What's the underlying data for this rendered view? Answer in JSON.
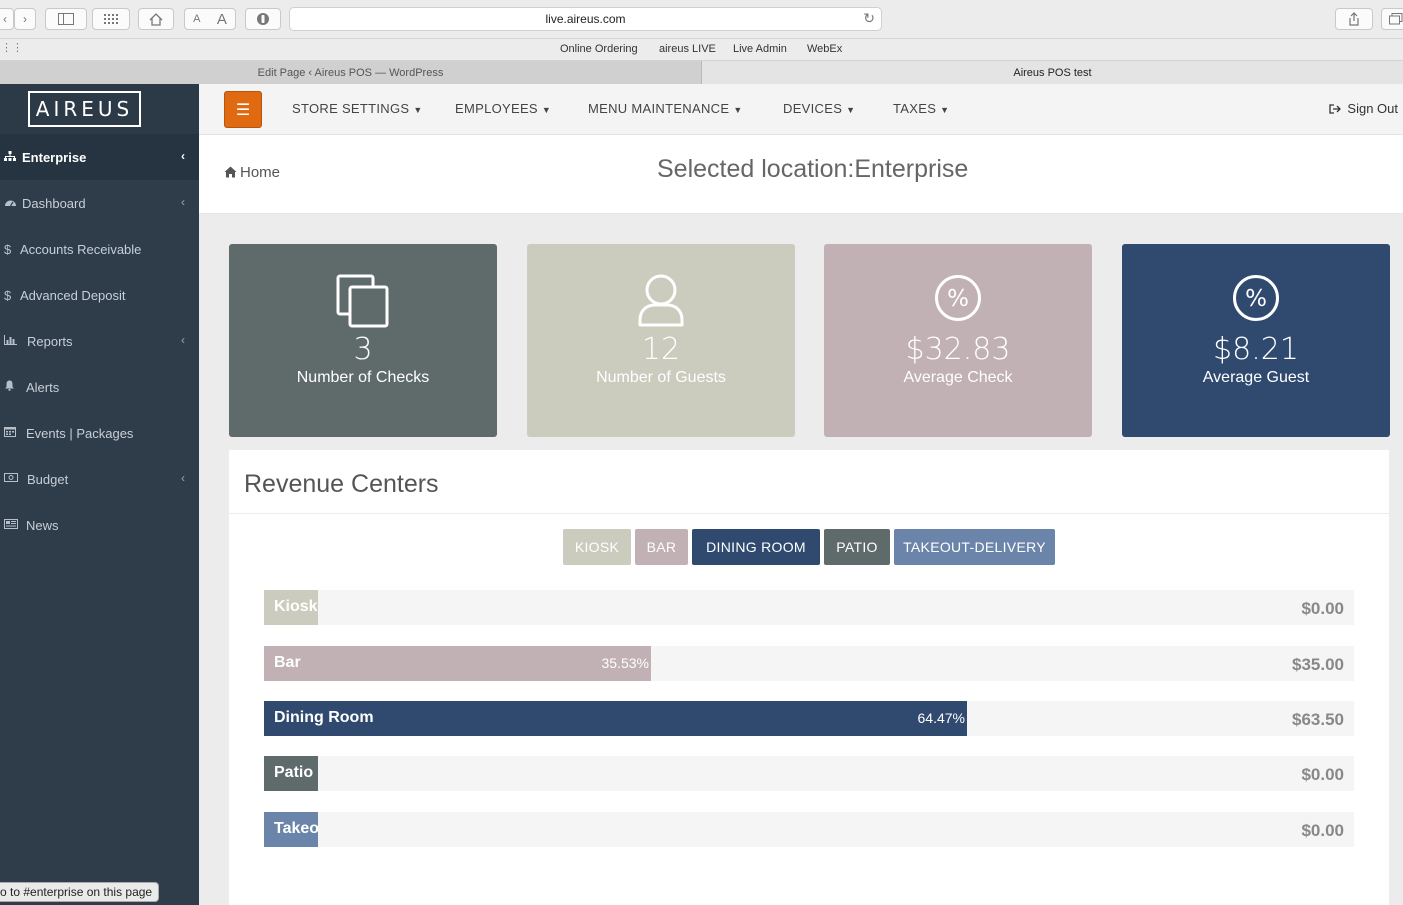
{
  "browser": {
    "url": "live.aireus.com",
    "bookmarks": [
      "Online Ordering",
      "aireus LIVE",
      "Live Admin",
      "WebEx"
    ],
    "tabs": [
      {
        "label": "Edit Page ‹ Aireus POS — WordPress",
        "active": false
      },
      {
        "label": "Aireus POS test",
        "active": true
      }
    ],
    "status_text": "o to #enterprise on this page",
    "font_small": "A",
    "font_large": "A"
  },
  "sidebar": {
    "logo": "AIREUS",
    "items": [
      {
        "label": "Enterprise",
        "icon": "sitemap-icon",
        "active": true,
        "chevron": true
      },
      {
        "label": "Dashboard",
        "icon": "dashboard-icon",
        "active": false,
        "chevron": true
      },
      {
        "label": "Accounts Receivable",
        "icon": "dollar-icon",
        "active": false,
        "chevron": false
      },
      {
        "label": "Advanced Deposit",
        "icon": "dollar-icon",
        "active": false,
        "chevron": false
      },
      {
        "label": "Reports",
        "icon": "bar-chart-icon",
        "active": false,
        "chevron": true
      },
      {
        "label": "Alerts",
        "icon": "bell-icon",
        "active": false,
        "chevron": false
      },
      {
        "label": "Events | Packages",
        "icon": "calendar-icon",
        "active": false,
        "chevron": false
      },
      {
        "label": "Budget",
        "icon": "money-icon",
        "active": false,
        "chevron": true
      },
      {
        "label": "News",
        "icon": "newspaper-icon",
        "active": false,
        "chevron": false
      }
    ]
  },
  "topnav": {
    "menus": [
      "STORE SETTINGS",
      "EMPLOYEES",
      "MENU MAINTENANCE",
      "DEVICES",
      "TAXES"
    ],
    "sign_out": "Sign Out"
  },
  "header": {
    "breadcrumb": "Home",
    "title": "Selected location:Enterprise"
  },
  "stats": [
    {
      "value": "3",
      "label": "Number of Checks",
      "icon": "copy-icon",
      "color": "#5f6b6b"
    },
    {
      "value": "12",
      "label": "Number of Guests",
      "icon": "user-icon",
      "color": "#cbcbbe"
    },
    {
      "value": "$32.83",
      "label": "Average Check",
      "icon": "percent-icon",
      "color": "#c1b0b4"
    },
    {
      "value": "$8.21",
      "label": "Average Guest",
      "icon": "percent-icon",
      "color": "#2f4a6e"
    }
  ],
  "revenue": {
    "title": "Revenue Centers",
    "filters": [
      {
        "label": "KIOSK",
        "color": "#cbcbbe"
      },
      {
        "label": "BAR",
        "color": "#c1b0b4"
      },
      {
        "label": "DINING ROOM",
        "color": "#2f4a6e"
      },
      {
        "label": "PATIO",
        "color": "#5f6b6b"
      },
      {
        "label": "TAKEOUT-DELIVERY",
        "color": "#6a85a9"
      }
    ],
    "bars": [
      {
        "label": "Kiosk",
        "percent": 0,
        "pct_text": "",
        "amount": "$0.00",
        "color": "#cbcbbe"
      },
      {
        "label": "Bar",
        "percent": 35.53,
        "pct_text": "35.53%",
        "amount": "$35.00",
        "color": "#c1b0b4"
      },
      {
        "label": "Dining Room",
        "percent": 64.47,
        "pct_text": "64.47%",
        "amount": "$63.50",
        "color": "#2f4a6e"
      },
      {
        "label": "Patio",
        "percent": 0,
        "pct_text": "",
        "amount": "$0.00",
        "color": "#5f6b6b"
      },
      {
        "label": "Takeout-Delivery",
        "percent": 0,
        "pct_text": "",
        "amount": "$0.00",
        "color": "#6a85a9"
      }
    ]
  }
}
